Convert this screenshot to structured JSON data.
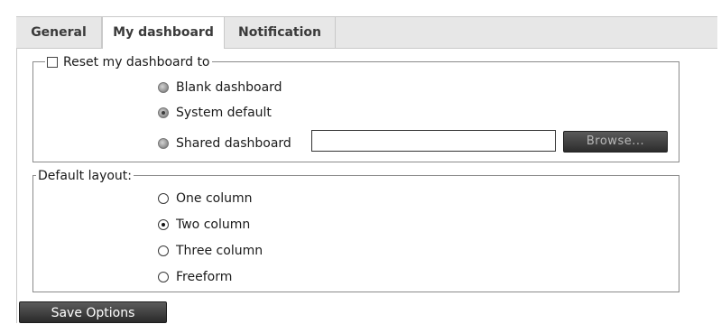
{
  "tabs": [
    {
      "label": "General",
      "active": false
    },
    {
      "label": "My dashboard",
      "active": true
    },
    {
      "label": "Notification",
      "active": false
    }
  ],
  "reset_group": {
    "legend": "Reset my dashboard to",
    "checked": false,
    "options": [
      {
        "label": "Blank dashboard",
        "selected": false
      },
      {
        "label": "System default",
        "selected": true
      },
      {
        "label": "Shared dashboard",
        "selected": false
      }
    ],
    "shared_value": "",
    "browse_label": "Browse..."
  },
  "layout_group": {
    "legend": "Default layout:",
    "options": [
      {
        "label": "One column",
        "selected": false
      },
      {
        "label": "Two column",
        "selected": true
      },
      {
        "label": "Three column",
        "selected": false
      },
      {
        "label": "Freeform",
        "selected": false
      }
    ]
  },
  "save_label": "Save Options"
}
